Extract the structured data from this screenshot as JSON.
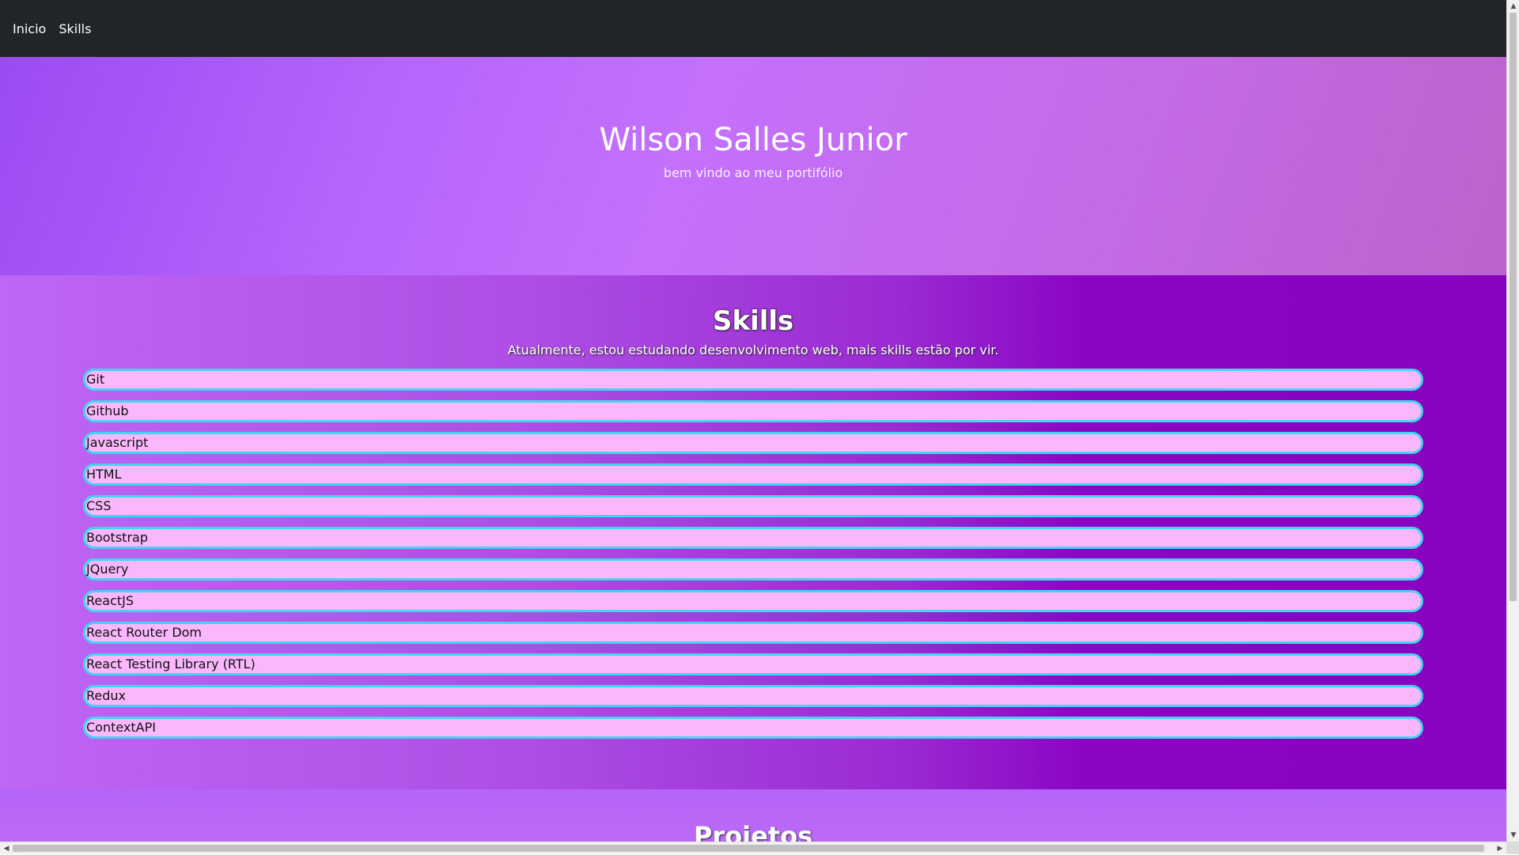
{
  "nav": {
    "links": [
      "Inicio",
      "Skills"
    ]
  },
  "hero": {
    "title": "Wilson Salles Junior",
    "subtitle": "bem vindo ao meu portifólio"
  },
  "skills": {
    "title": "Skills",
    "description": "Atualmente, estou estudando desenvolvimento web, mais skills estão por vir.",
    "items": [
      "Git",
      "Github",
      "Javascript",
      "HTML",
      "CSS",
      "Bootstrap",
      "JQuery",
      "ReactJS",
      "React Router Dom",
      "React Testing Library (RTL)",
      "Redux",
      "ContextAPI"
    ]
  },
  "projects": {
    "title": "Projetos"
  },
  "colors": {
    "navbar": "#212529",
    "skill_item_bg": "#fbb7fb",
    "skill_item_border": "#43d4f0"
  }
}
